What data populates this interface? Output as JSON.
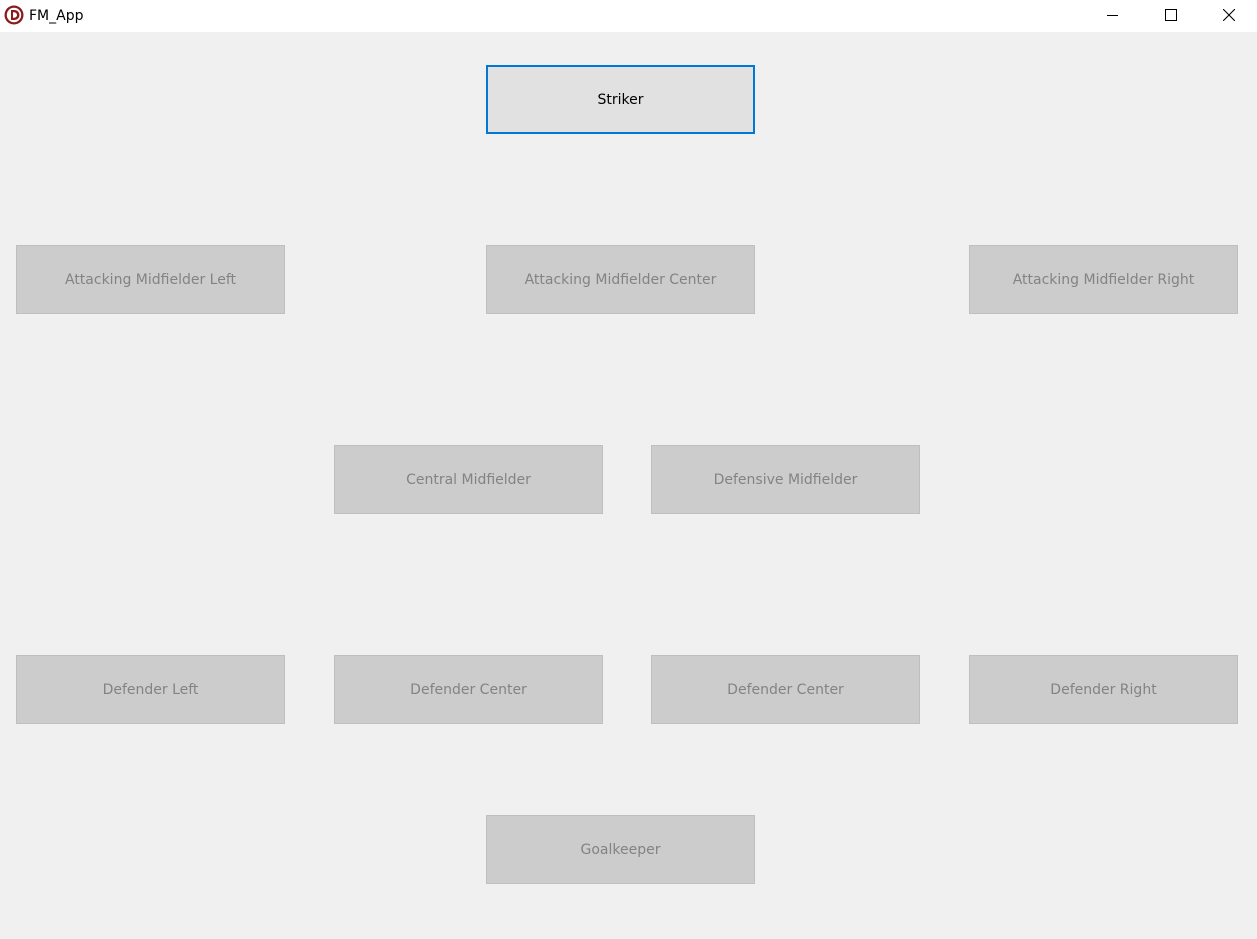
{
  "window": {
    "title": "FM_App",
    "controls": [
      "minimize-icon",
      "maximize-icon",
      "close-icon"
    ],
    "accent_color": "#0078d7"
  },
  "formation": {
    "striker": "Striker",
    "attacking_midfielder_left": "Attacking Midfielder Left",
    "attacking_midfielder_center": "Attacking Midfielder Center",
    "attacking_midfielder_right": "Attacking Midfielder Right",
    "central_midfielder": "Central Midfielder",
    "defensive_midfielder": "Defensive Midfielder",
    "defender_left": "Defender Left",
    "defender_center_1": "Defender Center",
    "defender_center_2": "Defender Center",
    "defender_right": "Defender Right",
    "goalkeeper": "Goalkeeper"
  }
}
